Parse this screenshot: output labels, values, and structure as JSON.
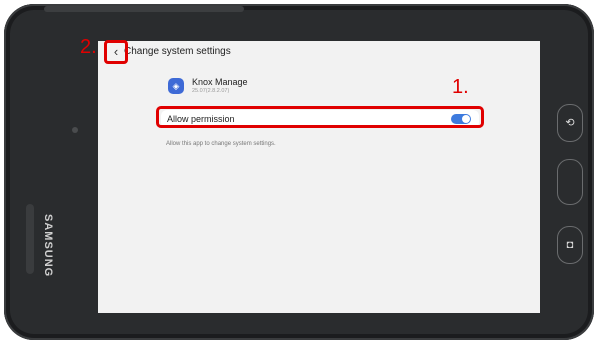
{
  "device": {
    "brand": "SAMSUNG"
  },
  "screen": {
    "topbar": {
      "title": "Change system settings"
    },
    "app": {
      "name": "Knox Manage",
      "version": "25.07(2.8.2.07)"
    },
    "permission": {
      "label": "Allow permission",
      "enabled": true
    },
    "description": "Allow this app to change system settings."
  },
  "annotations": {
    "step1": "1.",
    "step2": "2."
  },
  "colors": {
    "accent": "#3e7bde",
    "highlight": "#e00000",
    "appIcon": "#3e6ad6"
  }
}
